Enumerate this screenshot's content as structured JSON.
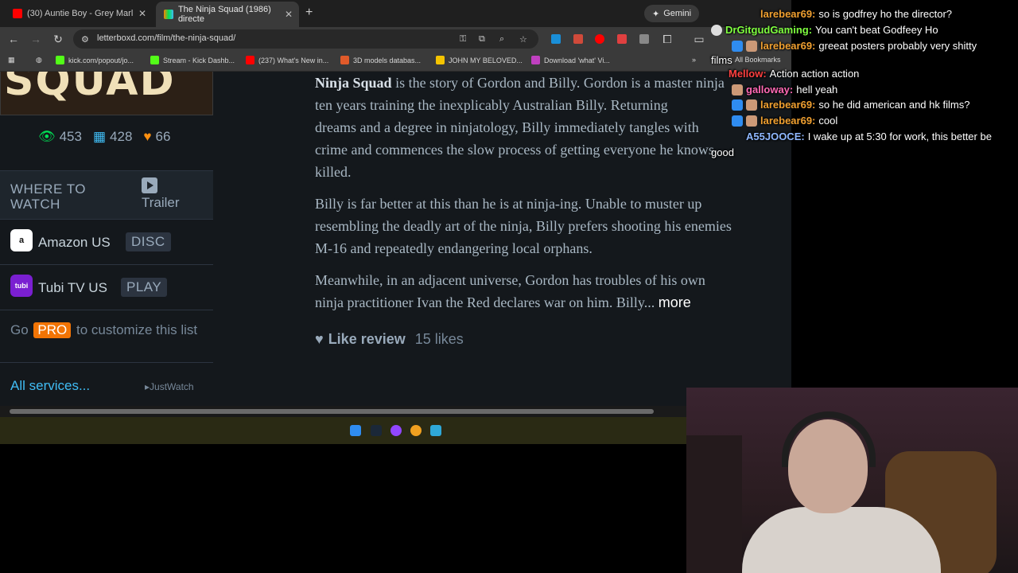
{
  "browser": {
    "tabs": [
      {
        "title": "(30) Auntie Boy - Grey Marl",
        "color": "#ff0000"
      },
      {
        "title": "The Ninja Squad (1986) directe",
        "color": "#00c030"
      }
    ],
    "gemini_label": "Gemini",
    "url": "letterboxd.com/film/the-ninja-squad/",
    "bookmarks": [
      {
        "label": "kick.com/popout/jo...",
        "color": "#53fc18"
      },
      {
        "label": "Stream - Kick Dashb...",
        "color": "#53fc18"
      },
      {
        "label": "(237) What's New in...",
        "color": "#ff0000"
      },
      {
        "label": "3D models databas...",
        "color": "#e05a2a"
      },
      {
        "label": "JOHN MY BELOVED...",
        "color": "#f5c400"
      },
      {
        "label": "Download 'what' Vi...",
        "color": "#c040c0"
      }
    ],
    "all_bookmarks": "All Bookmarks"
  },
  "film": {
    "poster_text": "SQUAD",
    "stats": {
      "watched": "453",
      "lists": "428",
      "likes": "66"
    },
    "where_to_watch": "WHERE TO WATCH",
    "trailer": "Trailer",
    "services": [
      {
        "name": "Amazon US",
        "tag": "DISC",
        "logo": "a"
      },
      {
        "name": "Tubi TV US",
        "tag": "PLAY",
        "logo": "tubi"
      }
    ],
    "promo_go": "Go",
    "promo_pro": "PRO",
    "promo_rest": "to customize this list",
    "all_services": "All services...",
    "justwatch": "JustWatch"
  },
  "review": {
    "p1_bold": "Ninja Squad",
    "p1_lines": [
      " is the story of Gordon and Billy. Gordon is a master ninja",
      "ten years training the inexplicably Australian Billy. Returning",
      "dreams and a degree in ninjatology, Billy immediately tangles with",
      "crime and commences the slow process of getting everyone he knows",
      "killed."
    ],
    "p2_lines": [
      "Billy is far better at this than he is at ninja-ing. Unable to muster up",
      "resembling the deadly art of the ninja, Billy prefers shooting his enemies",
      "M-16 and repeatedly endangering local orphans."
    ],
    "p3_lines": [
      "Meanwhile, in an adjacent universe, Gordon has troubles of his own",
      "ninja practitioner Ivan the Red declares war on him. Billy..."
    ],
    "more": "more",
    "like_label": "Like review",
    "likes": "15 likes"
  },
  "chat": [
    {
      "user": "larebear69:",
      "color": "#f0a030",
      "text": "so is godfrey ho the director?"
    },
    {
      "user": "DrGitgudGaming:",
      "color": "#7fff3f",
      "text": "You can't beat Godfeey Ho"
    },
    {
      "user": "larebear69:",
      "color": "#f0a030",
      "text": "greeat posters probably very shitty"
    },
    {
      "user": "",
      "color": "#ffffff",
      "text": "films"
    },
    {
      "user": "Mellow:",
      "color": "#ff4040",
      "text": "Action action action"
    },
    {
      "user": "galloway:",
      "color": "#ff69b4",
      "text": "hell yeah"
    },
    {
      "user": "larebear69:",
      "color": "#f0a030",
      "text": "so he did american and hk films?"
    },
    {
      "user": "larebear69:",
      "color": "#f0a030",
      "text": "cool"
    },
    {
      "user": "A55JOOCE:",
      "color": "#8fb8ff",
      "text": "I wake up at 5:30 for work, this better be"
    },
    {
      "user": "",
      "color": "#ffffff",
      "text": "good"
    }
  ],
  "icons": [
    "back-arrow-icon",
    "forward-arrow-icon",
    "reload-icon",
    "star-icon",
    "eye-icon",
    "grid-icon",
    "heart-icon",
    "play-icon"
  ]
}
